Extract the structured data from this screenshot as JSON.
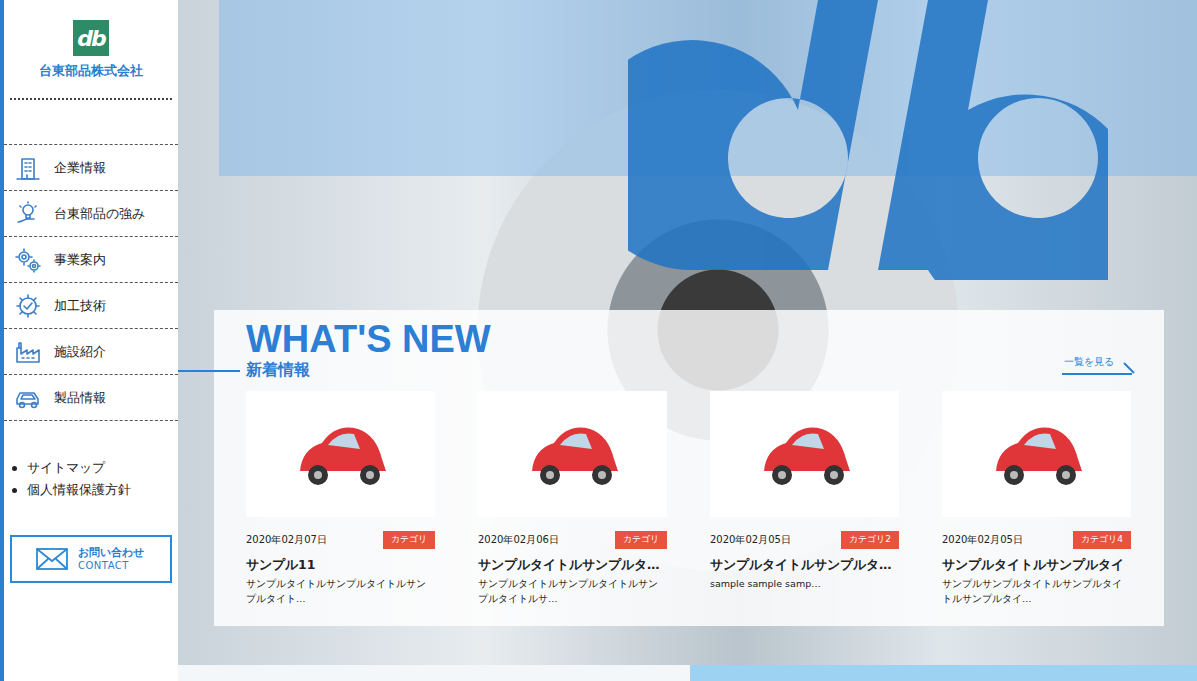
{
  "company": {
    "mark": "db",
    "name": "台東部品株式会社"
  },
  "nav": [
    {
      "label": "企業情報"
    },
    {
      "label": "台東部品の強み"
    },
    {
      "label": "事業案内"
    },
    {
      "label": "加工技術"
    },
    {
      "label": "施設紹介"
    },
    {
      "label": "製品情報"
    }
  ],
  "sublinks": [
    "サイトマップ",
    "個人情報保護方針"
  ],
  "contact": {
    "label": "お問い合わせ",
    "sub": "CONTACT"
  },
  "news": {
    "title": "WHAT'S NEW",
    "subtitle": "新着情報",
    "more": "一覧を見る",
    "items": [
      {
        "date": "2020年02月07日",
        "category": "カテゴリ",
        "title": "サンプル11",
        "excerpt": "サンプルタイトルサンプルタイトルサンプルタイト…"
      },
      {
        "date": "2020年02月06日",
        "category": "カテゴリ",
        "title": "サンプルタイトルサンプルタ…",
        "excerpt": "サンプルタイトルサンプルタイトルサンプルタイトルサ…"
      },
      {
        "date": "2020年02月05日",
        "category": "カテゴリ2",
        "title": "サンプルタイトルサンプルタ…",
        "excerpt": "sample sample samp…"
      },
      {
        "date": "2020年02月05日",
        "category": "カテゴリ4",
        "title": "サンプルタイトルサンプルタイ",
        "excerpt": "サンプルサンプルタイトルサンプルタイトルサンプルタイ…"
      }
    ]
  }
}
